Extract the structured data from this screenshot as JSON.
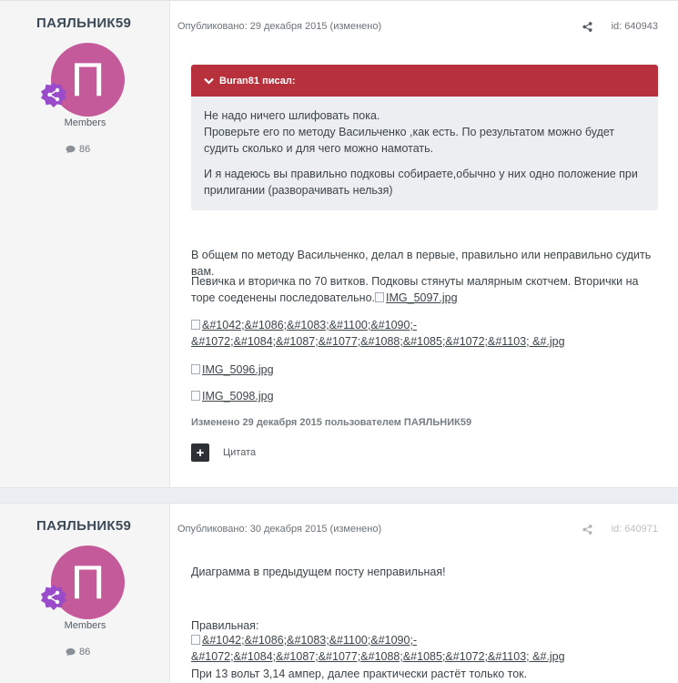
{
  "posts": [
    {
      "author": {
        "name": "ПАЯЛЬНИК59",
        "avatar_letter": "П",
        "group": "Members",
        "reputation": "86"
      },
      "meta": "Опубликовано: 29 декабря 2015 (изменено)",
      "post_id": "id: 640943",
      "quote": {
        "header": "Buran81 писал:",
        "paragraphs": [
          "Не надо ничего шлифовать пока.",
          "Проверьте его по методу Васильченко ,как есть. По результатом можно будет судить сколько и для чего можно намотать.",
          "И я надеюсь вы правильно подковы собираете,обычно у них одно положение при прилигании (разворачивать нельзя)"
        ]
      },
      "body": {
        "p1": "В общем по методу Васильченко, делал в первые, правильно или неправильно судить вам.",
        "p2": "Певичка и вторичка по 70 витков. Подковы стянуты малярным скотчем. Вторички на торе соеденены последовательно.",
        "img_inline": "IMG_5097.jpg",
        "img_a_line1": "&#1042;&#1086;&#1083;&#1100;&#1090;-",
        "img_a_line2": "&#1072;&#1084;&#1087;&#1077;&#1088;&#1085;&#1072;&#1103; &#.jpg",
        "img_b": "IMG_5096.jpg",
        "img_c": "IMG_5098.jpg"
      },
      "edit_note": "Изменено 29 декабря 2015 пользователем ПАЯЛЬНИК59",
      "quote_button_icon": "+",
      "quote_label": "Цитата"
    },
    {
      "author": {
        "name": "ПАЯЛЬНИК59",
        "avatar_letter": "П",
        "group": "Members",
        "reputation": "86"
      },
      "meta": "Опубликовано: 30 декабря 2015 (изменено)",
      "post_id": "id: 640971",
      "body": {
        "p1": "Диаграмма в предыдущем посту неправильная!",
        "p2": "Правильная:",
        "img_a_line1": "&#1042;&#1086;&#1083;&#1100;&#1090;-",
        "img_a_line2": "&#1072;&#1084;&#1087;&#1077;&#1088;&#1085;&#1072;&#1103; &#.jpg",
        "p3": "При 13 вольт 3,14 ампер, далее практически растёт только ток."
      }
    }
  ],
  "colors": {
    "quote_header": "#b7313c",
    "avatar": "#c45a9a",
    "badge": "#9a4bc9"
  }
}
